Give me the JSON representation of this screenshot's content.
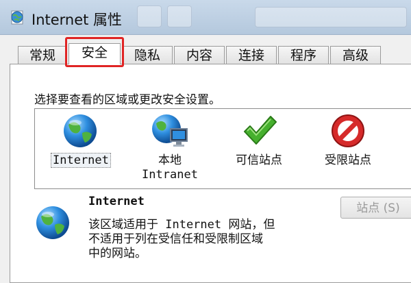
{
  "window": {
    "title": "Internet 属性",
    "app_icon": "globe-document-icon"
  },
  "tabs": [
    {
      "label": "常规",
      "active": false
    },
    {
      "label": "安全",
      "active": true
    },
    {
      "label": "隐私",
      "active": false
    },
    {
      "label": "内容",
      "active": false
    },
    {
      "label": "连接",
      "active": false
    },
    {
      "label": "程序",
      "active": false
    },
    {
      "label": "高级",
      "active": false
    }
  ],
  "security": {
    "instruction": "选择要查看的区域或更改安全设置。",
    "zones": [
      {
        "label": "Internet",
        "icon": "globe-icon",
        "selected": true
      },
      {
        "label": "本地",
        "label2": "Intranet",
        "icon": "globe-computer-icon",
        "selected": false
      },
      {
        "label": "可信站点",
        "icon": "green-check-icon",
        "selected": false
      },
      {
        "label": "受限站点",
        "icon": "no-entry-icon",
        "selected": false
      }
    ],
    "description": {
      "title": "Internet",
      "text": "该区域适用于 Internet 网站，但\n不适用于列在受信任和受限制区域\n中的网站。",
      "icon": "globe-icon"
    },
    "sites_button": "站点 (S)"
  },
  "colors": {
    "highlight": "#e02424",
    "titlebar": "#c9d9ea"
  }
}
